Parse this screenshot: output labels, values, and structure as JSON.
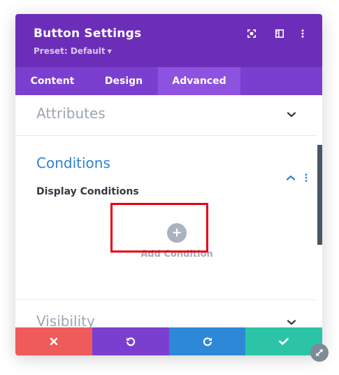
{
  "header": {
    "title": "Button Settings",
    "preset_label": "Preset: Default",
    "icons": [
      "expand-icon",
      "sidebar-toggle-icon",
      "more-vertical-icon"
    ]
  },
  "tabs": [
    {
      "label": "Content",
      "active": false
    },
    {
      "label": "Design",
      "active": false
    },
    {
      "label": "Advanced",
      "active": true
    }
  ],
  "sections": {
    "attributes": {
      "title": "Attributes",
      "expanded": false
    },
    "conditions": {
      "title": "Conditions",
      "expanded": true,
      "subheading": "Display Conditions",
      "add_label": "Add Condition",
      "add_icon": "+"
    },
    "visibility": {
      "title": "Visibility",
      "expanded": false
    }
  },
  "footer": {
    "buttons": [
      {
        "name": "discard",
        "icon": "close-icon",
        "color": "#ef5a5a"
      },
      {
        "name": "undo",
        "icon": "undo-icon",
        "color": "#7b3fd0"
      },
      {
        "name": "redo",
        "icon": "redo-icon",
        "color": "#2e88d8"
      },
      {
        "name": "save",
        "icon": "check-icon",
        "color": "#2cc4a7"
      }
    ]
  },
  "colors": {
    "header": "#6c2eb9",
    "tabs": "#7b3fd0",
    "active_tab": "#8e52e0",
    "accent_blue": "#2f81d6",
    "highlight_box": "#e8000f"
  }
}
